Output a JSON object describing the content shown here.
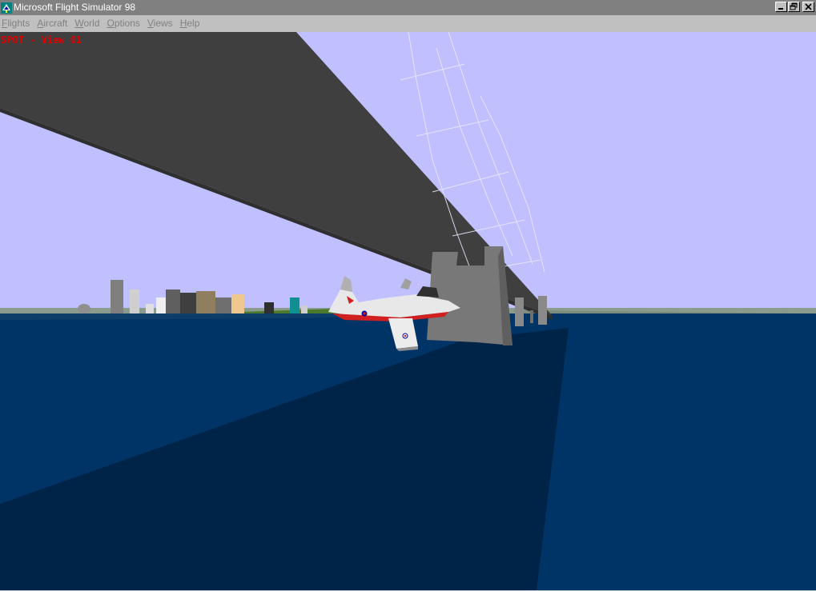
{
  "window": {
    "title": "Microsoft Flight Simulator 98",
    "icon": "fs98-app-icon",
    "controls": {
      "minimize": "minimize-icon",
      "restore": "restore-icon",
      "close": "close-icon"
    }
  },
  "menubar": {
    "items": [
      {
        "label_first": "F",
        "label_rest": "lights"
      },
      {
        "label_first": "A",
        "label_rest": "ircraft"
      },
      {
        "label_first": "W",
        "label_rest": "orld"
      },
      {
        "label_first": "O",
        "label_rest": "ptions"
      },
      {
        "label_first": "V",
        "label_rest": "iews"
      },
      {
        "label_first": "H",
        "label_rest": "elp"
      }
    ]
  },
  "viewport": {
    "view_label": "SPOT - View 01",
    "colors": {
      "sky": "#c0c0ff",
      "water": "#003366",
      "bridge_shadow": "#002447",
      "bridge_deck": "#3f3f3f",
      "bridge_pier": "#787878",
      "overlay_text": "#e00000"
    }
  }
}
